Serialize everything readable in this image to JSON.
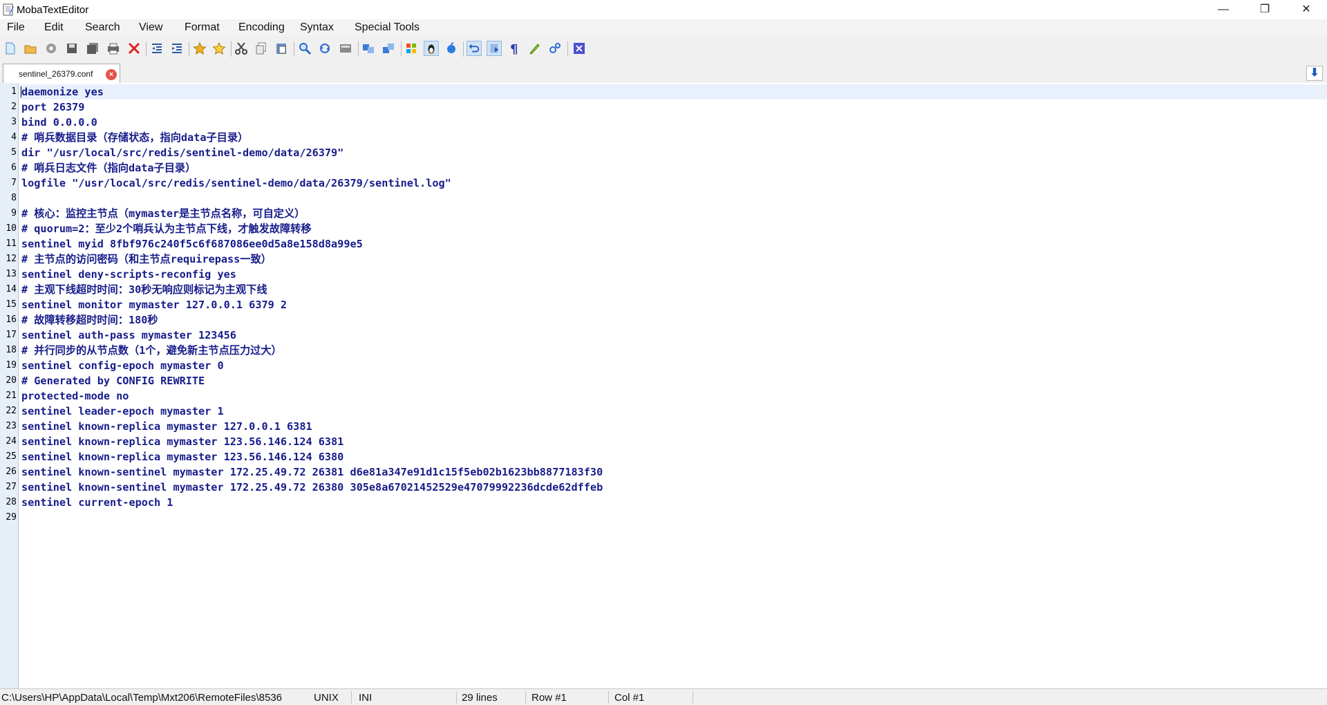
{
  "window": {
    "title": "MobaTextEditor",
    "min_glyph": "—",
    "max_glyph": "❐",
    "close_glyph": "✕"
  },
  "menu": [
    "File",
    "Edit",
    "Search",
    "View",
    "Format",
    "Encoding",
    "Syntax",
    "Special Tools"
  ],
  "toolbar": {
    "icons": [
      "new-file-icon",
      "open-folder-icon",
      "reload-icon",
      "save-icon",
      "save-all-icon",
      "print-icon",
      "close-red-x-icon",
      "outdent-icon",
      "indent-icon",
      "bookmark-icon",
      "bookmark-next-icon",
      "cut-icon",
      "copy-icon",
      "paste-icon",
      "find-icon",
      "find-replace-icon",
      "goto-icon",
      "compare-icon",
      "compare-alt-icon",
      "windows-icon",
      "linux-icon",
      "mac-icon",
      "undo-icon",
      "redo-icon",
      "pilcrow-icon",
      "highlight-icon",
      "settings-icon",
      "exit-icon"
    ]
  },
  "tab": {
    "label": "sentinel_26379.conf",
    "close_glyph": "×"
  },
  "scroll_end_glyph": "⬇",
  "editor": {
    "lines": [
      "daemonize yes",
      "port 26379",
      "bind 0.0.0.0",
      "# 哨兵数据目录（存储状态，指向data子目录）",
      "dir \"/usr/local/src/redis/sentinel-demo/data/26379\"",
      "# 哨兵日志文件（指向data子目录）",
      "logfile \"/usr/local/src/redis/sentinel-demo/data/26379/sentinel.log\"",
      "",
      "# 核心：监控主节点（mymaster是主节点名称，可自定义）",
      "# quorum=2：至少2个哨兵认为主节点下线，才触发故障转移",
      "sentinel myid 8fbf976c240f5c6f687086ee0d5a8e158d8a99e5",
      "# 主节点的访问密码（和主节点requirepass一致）",
      "sentinel deny-scripts-reconfig yes",
      "# 主观下线超时时间：30秒无响应则标记为主观下线",
      "sentinel monitor mymaster 127.0.0.1 6379 2",
      "# 故障转移超时时间：180秒",
      "sentinel auth-pass mymaster 123456",
      "# 并行同步的从节点数（1个，避免新主节点压力过大）",
      "sentinel config-epoch mymaster 0",
      "# Generated by CONFIG REWRITE",
      "protected-mode no",
      "sentinel leader-epoch mymaster 1",
      "sentinel known-replica mymaster 127.0.0.1 6381",
      "sentinel known-replica mymaster 123.56.146.124 6381",
      "sentinel known-replica mymaster 123.56.146.124 6380",
      "sentinel known-sentinel mymaster 172.25.49.72 26381 d6e81a347e91d1c15f5eb02b1623bb8877183f30",
      "sentinel known-sentinel mymaster 172.25.49.72 26380 305e8a67021452529e47079992236dcde62dffeb",
      "sentinel current-epoch 1",
      ""
    ]
  },
  "status": {
    "path": "C:\\Users\\HP\\AppData\\Local\\Temp\\Mxt206\\RemoteFiles\\8536",
    "line_ending": "UNIX",
    "syntax": "INI",
    "lines": "29 lines",
    "row": "Row #1",
    "col": "Col #1"
  },
  "colors": {
    "code_text": "#161c8a",
    "gutter_bg": "#e6eef8",
    "current_line_bg": "#e8f1fb"
  }
}
